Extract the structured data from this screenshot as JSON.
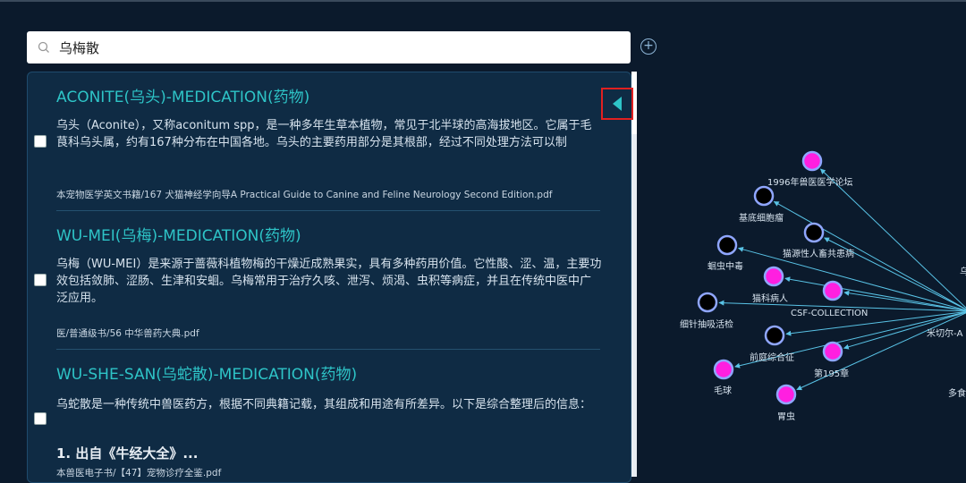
{
  "search": {
    "value": "乌梅散"
  },
  "add_button": {
    "label": "+"
  },
  "results": [
    {
      "title": "ACONITE(乌头)-MEDICATION(药物)",
      "desc": "乌头（Aconite），又称aconitum spp，是一种多年生草本植物，常见于北半球的高海拔地区。它属于毛茛科乌头属，约有167种分布在中国各地。乌头的主要药用部分是其根部，经过不同处理方法可以制",
      "source": "本宠物医学英文书籍/167 犬猫神经学向导A Practical Guide to Canine and Feline Neurology Second Edition.pdf"
    },
    {
      "title": "WU-MEI(乌梅)-MEDICATION(药物)",
      "desc": "乌梅（WU-MEI）是来源于蔷薇科植物梅的干燥近成熟果实，具有多种药用价值。它性酸、涩、温，主要功效包括敛肺、涩肠、生津和安蛔。乌梅常用于治疗久咳、泄泻、烦渴、虫积等病症，并且在传统中医中广泛应用。",
      "source": "医/普通级书/56 中华兽药大典.pdf"
    },
    {
      "title": "WU-SHE-SAN(乌蛇散)-MEDICATION(药物)",
      "desc": "乌蛇散是一种传统中兽医药方，根据不同典籍记载，其组成和用途有所差异。以下是综合整理后的信息：",
      "sub": "1. 出自《牛经大全》...",
      "source": "本兽医电子书/【47】宠物诊疗全鉴.pdf"
    }
  ],
  "graph": {
    "nodes": [
      {
        "label": "1996年兽医医学论坛",
        "color": "#ff1fe0"
      },
      {
        "label": "基底细胞瘤",
        "color": "#000000"
      },
      {
        "label": "猫源性人畜共患病",
        "color": "#000000"
      },
      {
        "label": "蛔虫中毒",
        "color": "#000000"
      },
      {
        "label": "猫科病人",
        "color": "#ff1fe0"
      },
      {
        "label": "CSF-COLLECTION",
        "color": "#ff1fe0"
      },
      {
        "label": "细针抽吸活检",
        "color": "#000000"
      },
      {
        "label": "前庭综合征",
        "color": "#000000"
      },
      {
        "label": "第195章",
        "color": "#ff1fe0"
      },
      {
        "label": "毛球",
        "color": "#ff1fe0"
      },
      {
        "label": "胃虫",
        "color": "#ff1fe0"
      }
    ],
    "edge_labels": [
      "乌",
      "米切尔-A",
      "多食"
    ],
    "edge_color": "#59c3e6",
    "node_border": "#8fa6ff"
  }
}
